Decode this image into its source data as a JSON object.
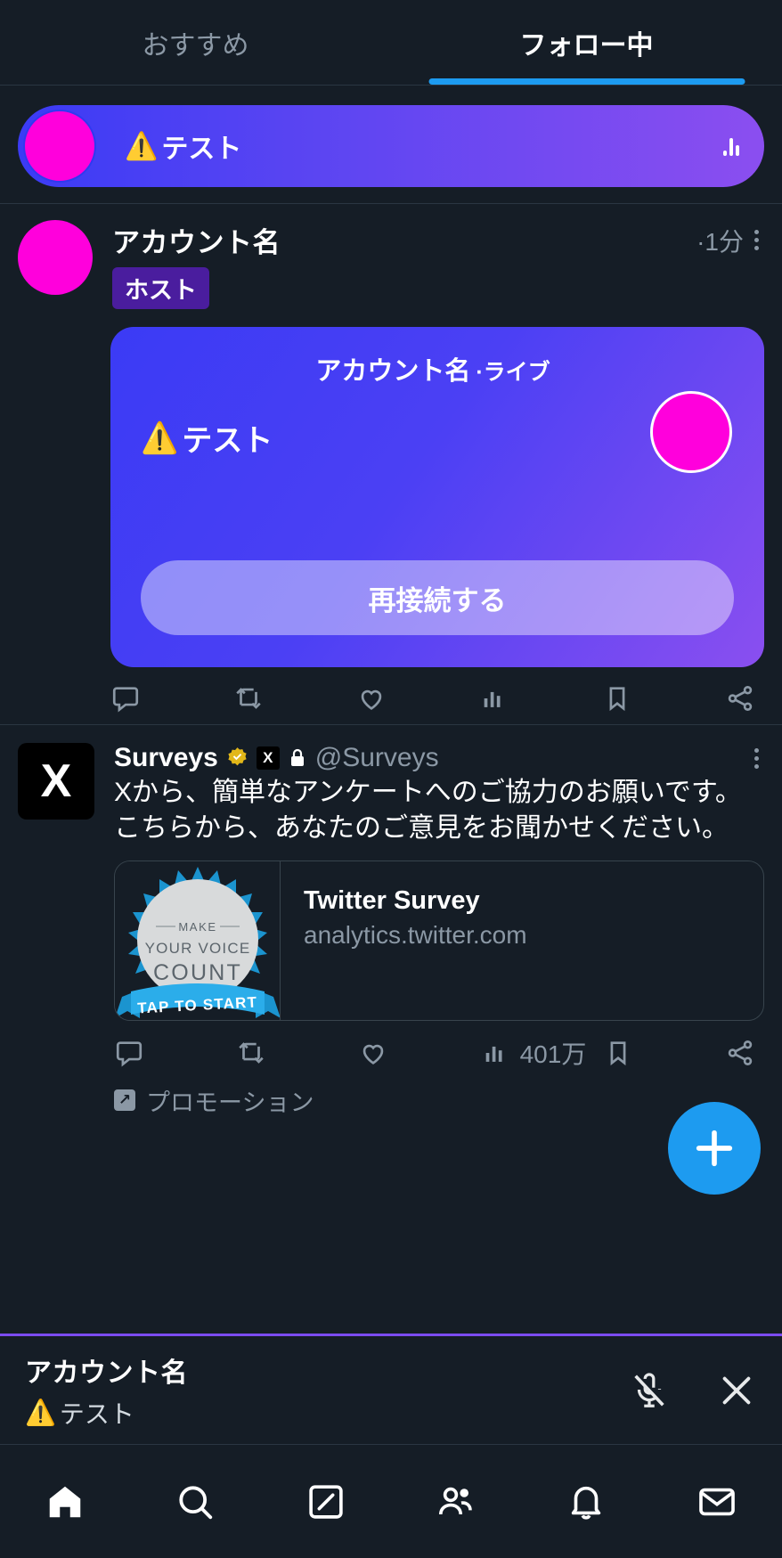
{
  "tabs": [
    {
      "label": "おすすめ",
      "active": false
    },
    {
      "label": "フォロー中",
      "active": true
    }
  ],
  "live_banner": {
    "title": "テスト",
    "warning_icon": "⚠️",
    "avatar_color": "#ff00dc",
    "equalizer_icon": "audio-levels-icon"
  },
  "tweet_live": {
    "author": "アカウント名",
    "timestamp": "·1分",
    "host_badge": "ホスト",
    "more_icon": "more-options-icon",
    "card": {
      "author": "アカウント名",
      "live_label": "·ライブ",
      "warning_icon": "⚠️",
      "status_text": "テスト",
      "button_label": "再接続する"
    },
    "actions": [
      {
        "name": "reply",
        "count": ""
      },
      {
        "name": "retweet",
        "count": ""
      },
      {
        "name": "like",
        "count": ""
      },
      {
        "name": "views",
        "count": ""
      },
      {
        "name": "bookmark",
        "count": ""
      },
      {
        "name": "share",
        "count": ""
      }
    ]
  },
  "tweet_promoted": {
    "logo": "X",
    "author": "Surveys",
    "verified_badge": "gold-verified-icon",
    "affiliate_badge": "X",
    "protected_icon": "lock-icon",
    "handle": "@Surveys",
    "more_icon": "more-options-icon",
    "text": "Xから、簡単なアンケートへのご協力のお願いです。こちらから、あなたのご意見をお聞かせください。",
    "link_card": {
      "image_lines": [
        "MAKE",
        "YOUR VOICE",
        "COUNT"
      ],
      "ribbon_text": "TAP TO START",
      "title": "Twitter Survey",
      "domain": "analytics.twitter.com"
    },
    "actions": [
      {
        "name": "reply",
        "count": ""
      },
      {
        "name": "retweet",
        "count": ""
      },
      {
        "name": "like",
        "count": ""
      },
      {
        "name": "views",
        "count": "401万"
      },
      {
        "name": "bookmark",
        "count": ""
      },
      {
        "name": "share",
        "count": ""
      }
    ],
    "promoted_label": "プロモーション"
  },
  "compose_fab": {
    "icon": "plus-icon",
    "color": "#1d9bf0"
  },
  "mini_player": {
    "title": "アカウント名",
    "warning_icon": "⚠️",
    "subtitle": "テスト",
    "mic_icon": "mic-off-icon",
    "close_icon": "close-icon",
    "accent": "#7b4bf0"
  },
  "bottom_nav": [
    {
      "name": "home",
      "active": true
    },
    {
      "name": "search",
      "active": false
    },
    {
      "name": "compose",
      "active": false
    },
    {
      "name": "communities",
      "active": false
    },
    {
      "name": "notifications",
      "active": false
    },
    {
      "name": "messages",
      "active": false
    }
  ]
}
